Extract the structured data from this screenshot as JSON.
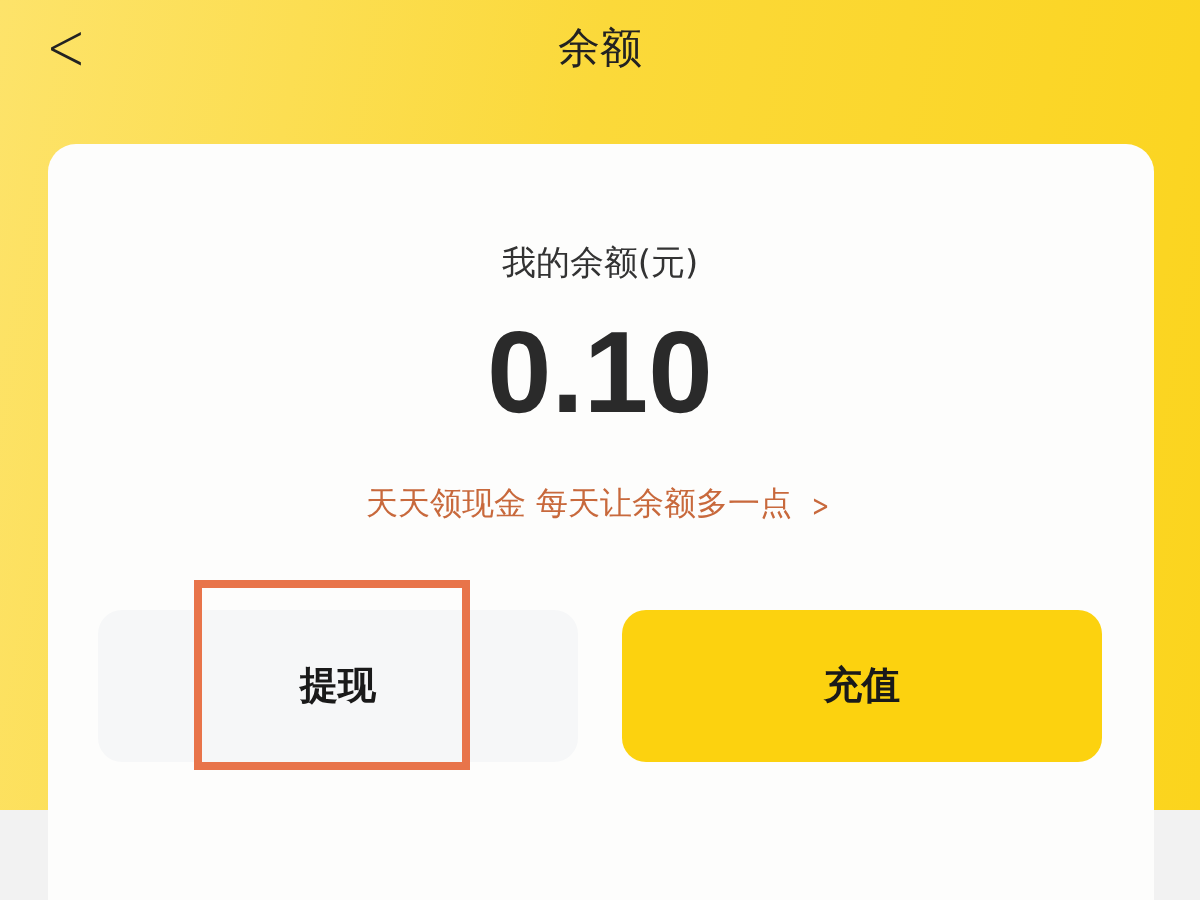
{
  "header": {
    "back": "<",
    "title": "余额"
  },
  "balance": {
    "label": "我的余额(元)",
    "amount": "0.10"
  },
  "promo_link": {
    "text": "天天领现金 每天让余额多一点",
    "chevron": ">"
  },
  "buttons": [
    {
      "label": "提现",
      "kind": "secondary",
      "highlighted": true
    },
    {
      "label": "充值",
      "kind": "primary",
      "highlighted": false
    }
  ]
}
